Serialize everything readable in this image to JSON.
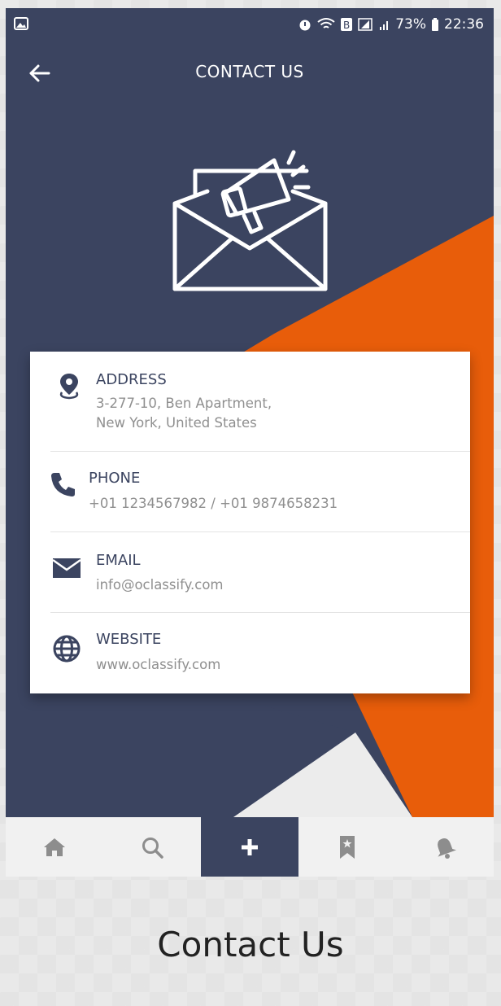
{
  "status_bar": {
    "battery": "73%",
    "time": "22:36"
  },
  "header": {
    "title": "CONTACT US",
    "back_icon": "arrow-left-icon"
  },
  "hero": {
    "icon": "envelope-megaphone-icon"
  },
  "contact": {
    "items": [
      {
        "icon": "location-pin-icon",
        "label": "ADDRESS",
        "value": "3-277-10, Ben Apartment,\nNew York, United States"
      },
      {
        "icon": "phone-icon",
        "label": "PHONE",
        "value": "+01 1234567982 / +01 9874658231"
      },
      {
        "icon": "mail-icon",
        "label": "EMAIL",
        "value": "info@oclassify.com"
      },
      {
        "icon": "globe-icon",
        "label": "WEBSITE",
        "value": "www.oclassify.com"
      }
    ]
  },
  "bottom_nav": {
    "items": [
      {
        "icon": "home-icon",
        "active": false
      },
      {
        "icon": "search-icon",
        "active": false
      },
      {
        "icon": "plus-icon",
        "active": true
      },
      {
        "icon": "bookmark-icon",
        "active": false
      },
      {
        "icon": "bell-icon",
        "active": false
      }
    ]
  },
  "caption": "Contact Us",
  "colors": {
    "navy": "#3b4460",
    "orange": "#e85d0a",
    "card": "#ffffff",
    "muted_text": "#8f8f8f"
  }
}
